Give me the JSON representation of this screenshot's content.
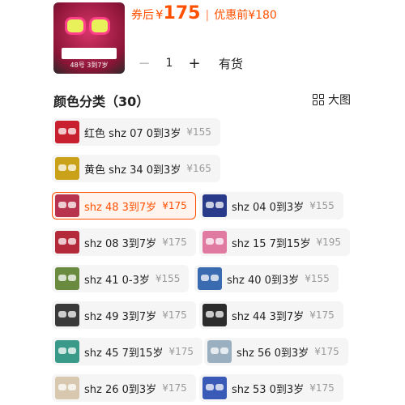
{
  "header": {
    "coupon_label": "券后",
    "currency": "¥",
    "coupon_price": "175",
    "separator": "|",
    "original_label": "优惠前",
    "original_price": "¥180",
    "thumb_caption": "48号 3到7岁"
  },
  "quantity": {
    "minus": "−",
    "value": "1",
    "plus": "+"
  },
  "stock_status": "有货",
  "section": {
    "title": "颜色分类（30）",
    "view_toggle": "大图"
  },
  "options": [
    {
      "name": "红色 shz 07 0到3岁",
      "price": "¥155",
      "color": "#c8202e",
      "selected": false
    },
    {
      "name": "黄色 shz 34 0到3岁",
      "price": "¥165",
      "color": "#c9a21a",
      "selected": false
    },
    {
      "name": "shz 48 3到7岁",
      "price": "¥175",
      "color": "#b8344e",
      "selected": true
    },
    {
      "name": "shz 04 0到3岁",
      "price": "¥155",
      "color": "#2a3a8a",
      "selected": false
    },
    {
      "name": "shz 08 3到7岁",
      "price": "¥175",
      "color": "#b52a3a",
      "selected": false
    },
    {
      "name": "shz 15 7到15岁",
      "price": "¥195",
      "color": "#e07aa0",
      "selected": false
    },
    {
      "name": "shz 41 0-3岁",
      "price": "¥155",
      "color": "#6a8a40",
      "selected": false
    },
    {
      "name": "shz 40 0到3岁",
      "price": "¥155",
      "color": "#3a6ab0",
      "selected": false
    },
    {
      "name": "shz 49 3到7岁",
      "price": "¥175",
      "color": "#3a3a3a",
      "selected": false
    },
    {
      "name": "shz 44 3到7岁",
      "price": "¥175",
      "color": "#2c2c2c",
      "selected": false
    },
    {
      "name": "shz 45 7到15岁",
      "price": "¥175",
      "color": "#3a9a8a",
      "selected": false
    },
    {
      "name": "shz 56 0到3岁",
      "price": "¥175",
      "color": "#9ab0c0",
      "selected": false
    },
    {
      "name": "shz 26 0到3岁",
      "price": "¥175",
      "color": "#d8c8b0",
      "selected": false
    },
    {
      "name": "shz 53 0到3岁",
      "price": "¥175",
      "color": "#3a5ab8",
      "selected": false
    }
  ]
}
